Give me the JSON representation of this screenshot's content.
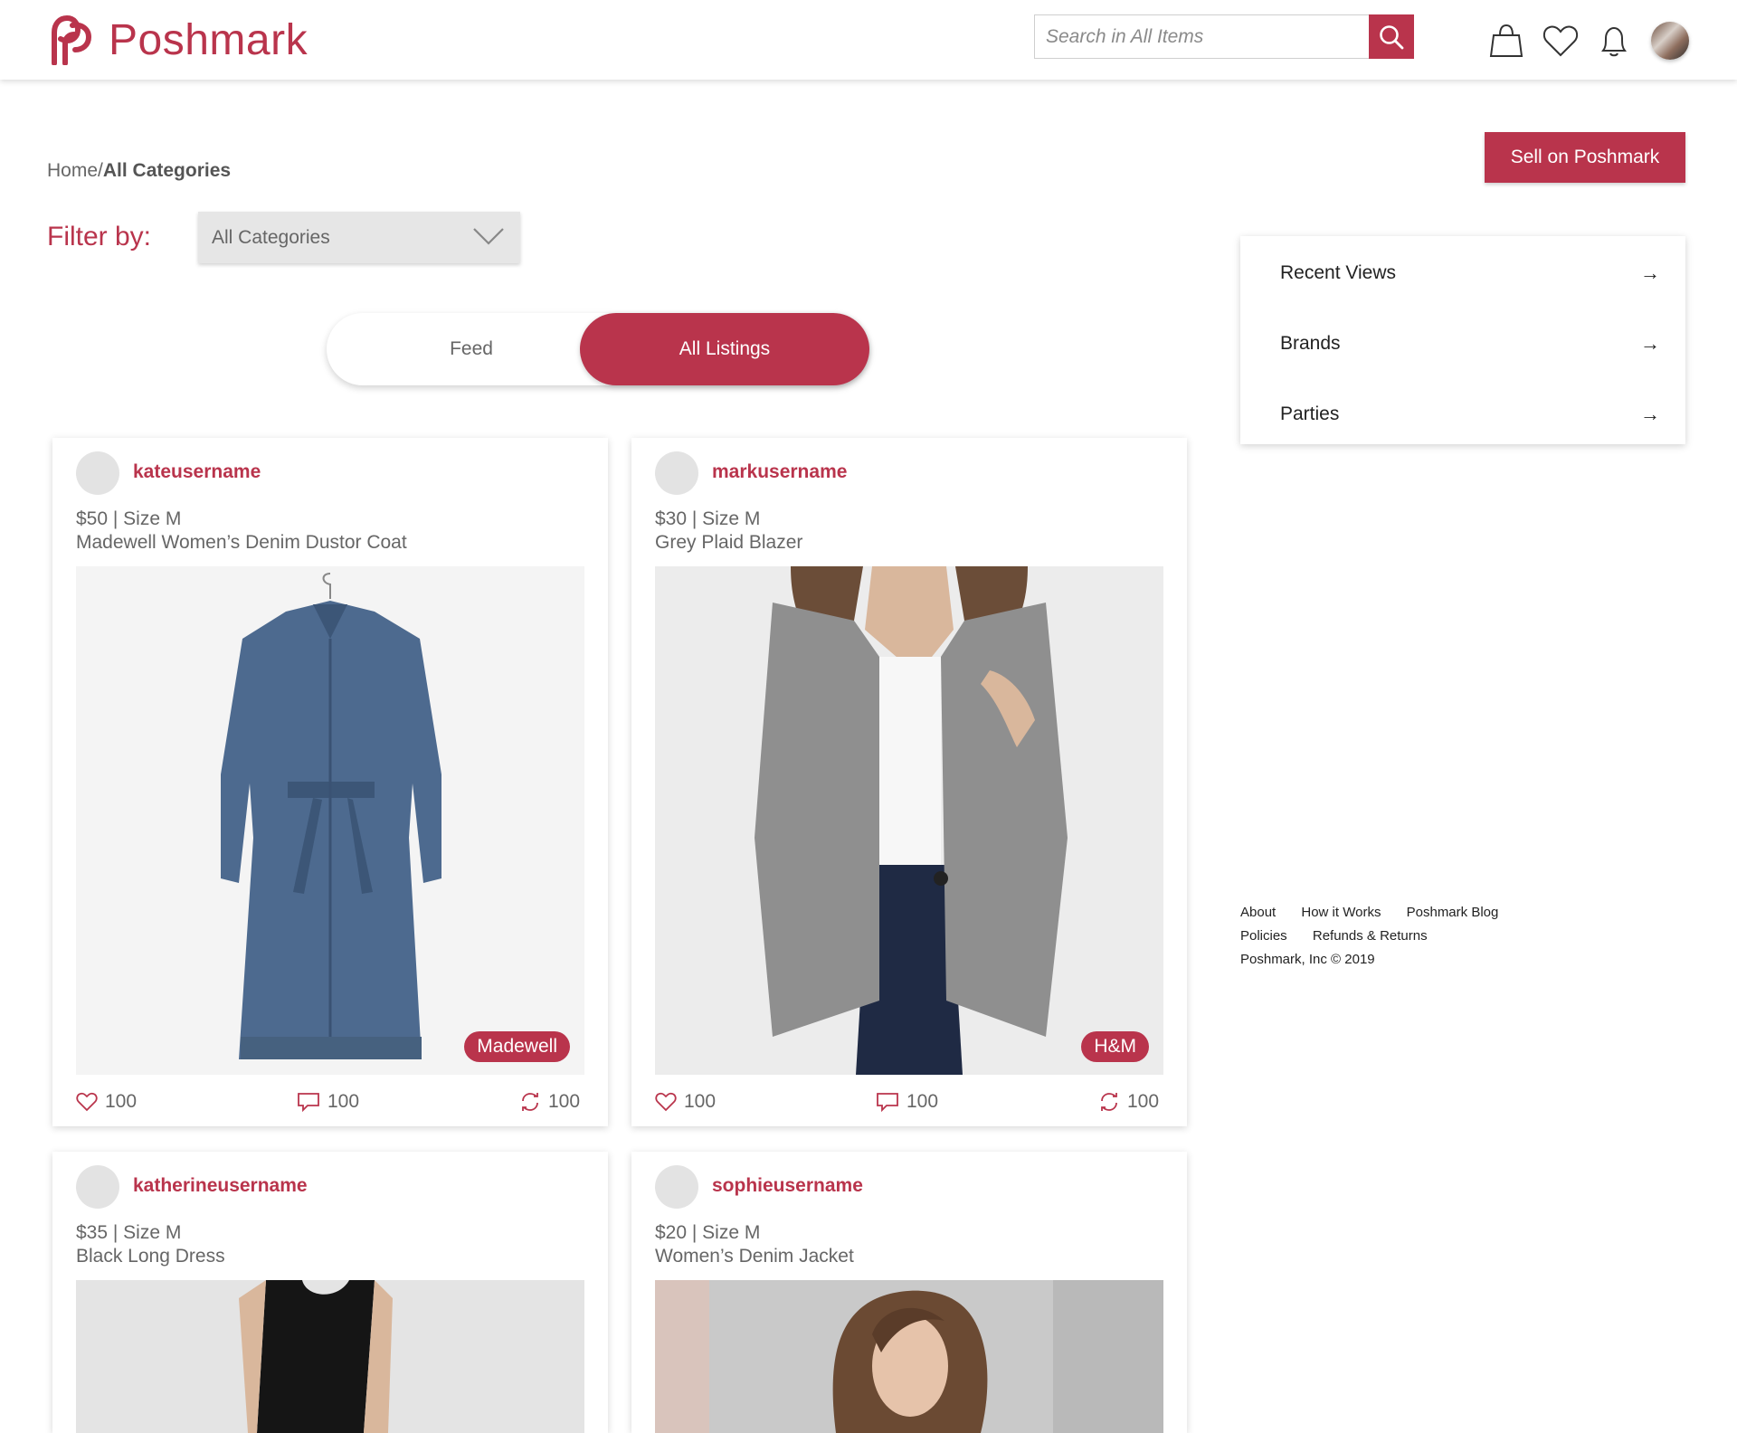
{
  "header": {
    "brand": "Poshmark",
    "search_placeholder": "Search in All Items",
    "icons": [
      "search-icon",
      "shopping-bag-icon",
      "heart-icon",
      "bell-icon",
      "profile-avatar"
    ]
  },
  "breadcrumb": {
    "home": "Home/",
    "current": "All Categories"
  },
  "filter": {
    "label": "Filter by:",
    "selected": "All Categories"
  },
  "toggle": {
    "feed": "Feed",
    "all_listings": "All Listings",
    "active": "All Listings"
  },
  "sell_button": "Sell on Poshmark",
  "side_panel": {
    "items": [
      {
        "label": "Recent Views",
        "arrow": "→"
      },
      {
        "label": "Brands",
        "arrow": "→"
      },
      {
        "label": "Parties",
        "arrow": "→"
      }
    ]
  },
  "footer": {
    "links_row1": [
      "About",
      "How it Works",
      "Poshmark Blog"
    ],
    "links_row2": [
      "Policies",
      "Refunds & Returns"
    ],
    "copyright": "Poshmark, Inc © 2019"
  },
  "listings": [
    {
      "username": "kateusername",
      "price_size": "$50 | Size M",
      "title": "Madewell Women’s Denim Dustor Coat",
      "brand": "Madewell",
      "likes": "100",
      "comments": "100",
      "shares": "100"
    },
    {
      "username": "markusername",
      "price_size": "$30 | Size M",
      "title": "Grey Plaid Blazer",
      "brand": "H&M",
      "likes": "100",
      "comments": "100",
      "shares": "100"
    },
    {
      "username": "katherineusername",
      "price_size": "$35 | Size M",
      "title": "Black Long Dress",
      "brand": "",
      "likes": "",
      "comments": "",
      "shares": ""
    },
    {
      "username": "sophieusername",
      "price_size": "$20 | Size M",
      "title": "Women’s Denim Jacket",
      "brand": "",
      "likes": "",
      "comments": "",
      "shares": ""
    }
  ],
  "colors": {
    "accent": "#b9344c",
    "text_muted": "#666666",
    "panel_shadow": "#d0d0d0"
  }
}
